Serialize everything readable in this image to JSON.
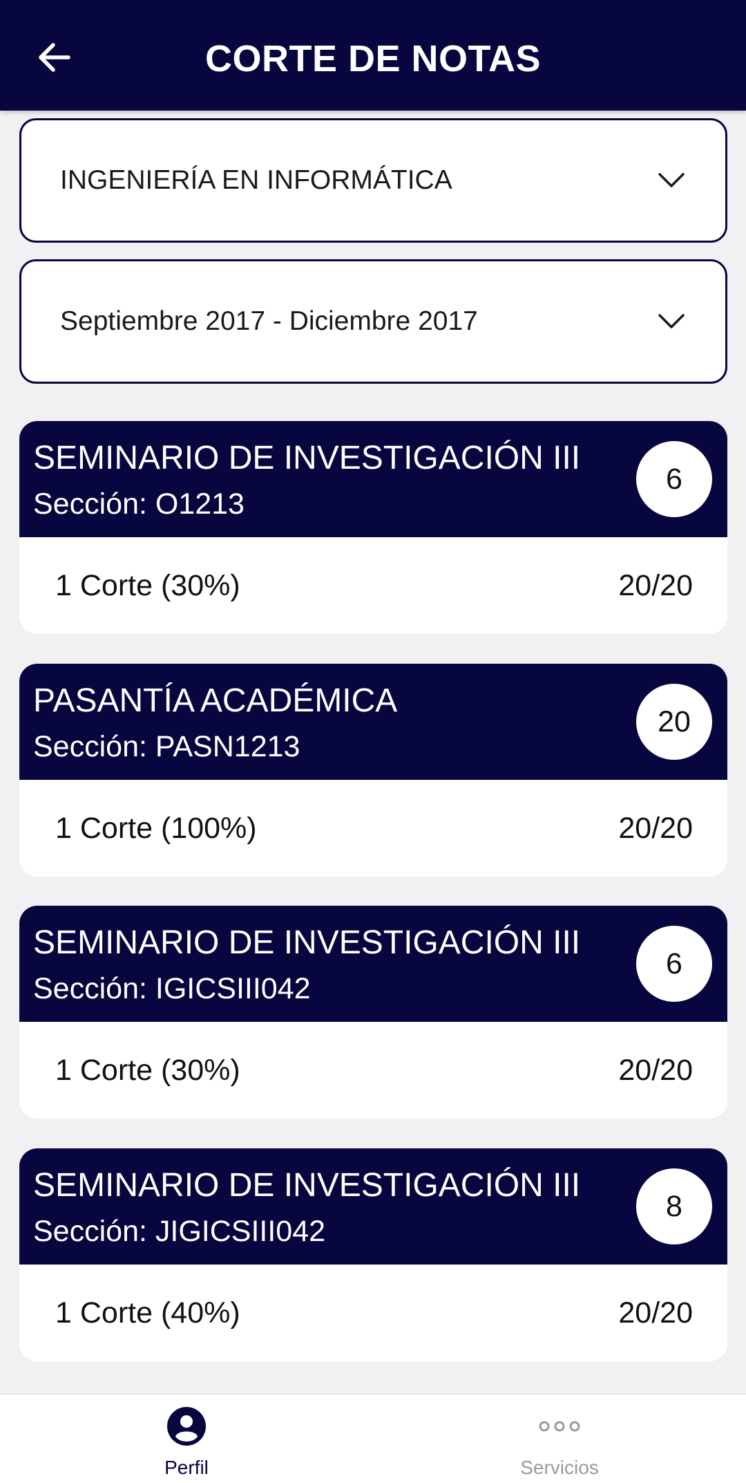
{
  "header": {
    "title": "CORTE DE NOTAS",
    "back_icon": "arrow-left-icon"
  },
  "filters": {
    "career": "INGENIERÍA EN INFORMÁTICA",
    "period": "Septiembre 2017 - Diciembre 2017"
  },
  "courses": [
    {
      "name": "SEMINARIO DE INVESTIGACIÓN III",
      "section": "Sección: O1213",
      "credits": "6",
      "cut": "1 Corte (30%)",
      "grade": "20/20"
    },
    {
      "name": "PASANTÍA ACADÉMICA",
      "section": "Sección: PASN1213",
      "credits": "20",
      "cut": "1 Corte (100%)",
      "grade": "20/20"
    },
    {
      "name": "SEMINARIO DE INVESTIGACIÓN III",
      "section": "Sección: IGICSIII042",
      "credits": "6",
      "cut": "1 Corte (30%)",
      "grade": "20/20"
    },
    {
      "name": "SEMINARIO DE INVESTIGACIÓN III",
      "section": "Sección: JIGICSIII042",
      "credits": "8",
      "cut": "1 Corte (40%)",
      "grade": "20/20"
    }
  ],
  "bottom_nav": {
    "items": [
      {
        "label": "Perfil",
        "icon": "person-icon",
        "active": true
      },
      {
        "label": "Servicios",
        "icon": "more-dots-icon",
        "active": false
      }
    ]
  },
  "colors": {
    "primary": "#07063f",
    "background": "#f1f1f3",
    "inactive": "#9a9a9a"
  }
}
